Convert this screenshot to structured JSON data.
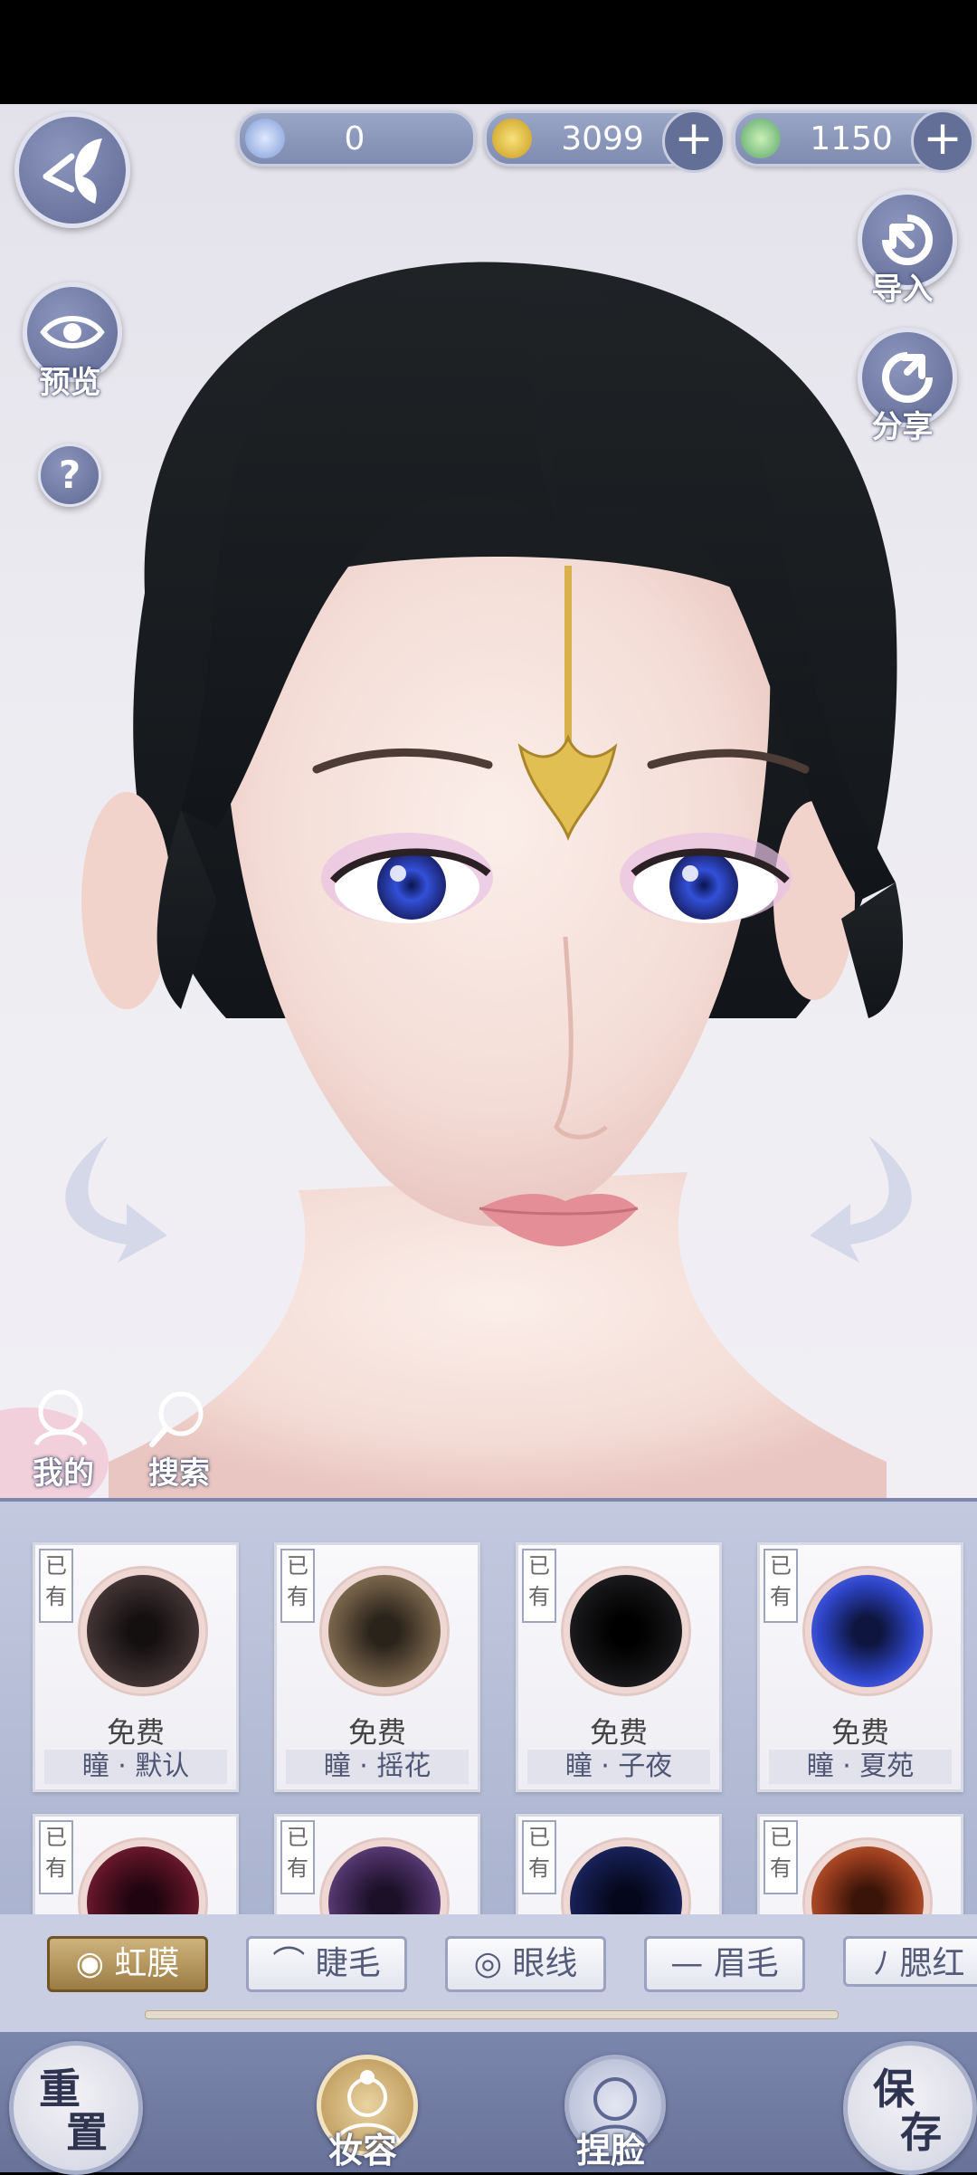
{
  "currencies": [
    {
      "value": "0",
      "icon": "feather-gem-icon",
      "plus": false
    },
    {
      "value": "3099",
      "icon": "gold-coin-icon",
      "plus": true
    },
    {
      "value": "1150",
      "icon": "jade-swirl-icon",
      "plus": true
    }
  ],
  "left_controls": {
    "preview": "预览",
    "help": "?"
  },
  "right_controls": {
    "import": "导入",
    "share": "分享"
  },
  "scene_controls": {
    "mine": "我的",
    "search": "搜索"
  },
  "items": [
    {
      "owned": "已有",
      "price": "免费",
      "name": "瞳 · 默认",
      "color": "#3a2d2e"
    },
    {
      "owned": "已有",
      "price": "免费",
      "name": "瞳 · 摇花",
      "color": "#6d5a44"
    },
    {
      "owned": "已有",
      "price": "免费",
      "name": "瞳 · 子夜",
      "color": "#141416"
    },
    {
      "owned": "已有",
      "price": "免费",
      "name": "瞳 · 夏苑",
      "color": "#2e44c8"
    },
    {
      "owned": "已有",
      "price": "",
      "name": "",
      "color": "#5a1325"
    },
    {
      "owned": "已有",
      "price": "",
      "name": "",
      "color": "#4a2f63"
    },
    {
      "owned": "已有",
      "price": "",
      "name": "",
      "color": "#141c4d"
    },
    {
      "owned": "已有",
      "price": "",
      "name": "",
      "color": "#9a3d1f"
    }
  ],
  "tabs": [
    {
      "label": "虹膜",
      "icon": "iris-icon",
      "active": true
    },
    {
      "label": "睫毛",
      "icon": "eyelash-icon",
      "active": false
    },
    {
      "label": "眼线",
      "icon": "eyeliner-icon",
      "active": false
    },
    {
      "label": "眉毛",
      "icon": "eyebrow-icon",
      "active": false
    },
    {
      "label": "腮红",
      "icon": "blush-icon",
      "active": false
    }
  ],
  "nav": {
    "reset_a": "重",
    "reset_b": "置",
    "makeup": "妆容",
    "face": "捏脸",
    "save_a": "保",
    "save_b": "存"
  }
}
